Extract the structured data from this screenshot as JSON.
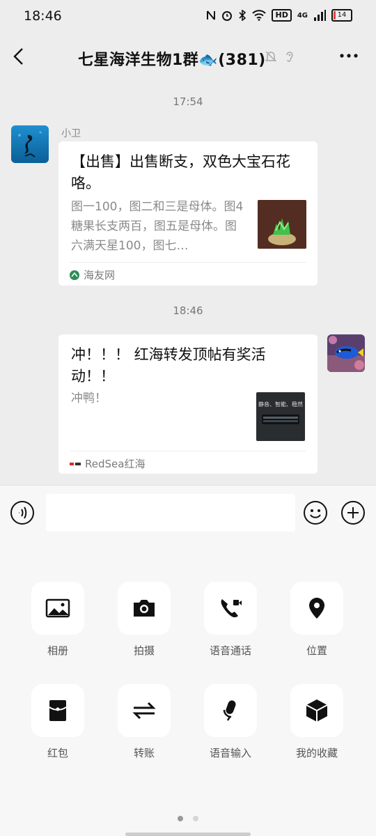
{
  "status_bar": {
    "time": "18:46",
    "hd_label": "HD",
    "network_label": "4G",
    "battery": "14",
    "battery_level": 0.14
  },
  "header": {
    "title": "七星海洋生物1群🐟(381)"
  },
  "messages": {
    "time1": "17:54",
    "sender_name": "小卫",
    "card1": {
      "title": "【出售】出售断支，双色大宝石花咯。",
      "desc": "图一100，图二和三是母体。图4糖果长支两百，图五是母体。图六满天星100，图七…",
      "source": "海友网"
    },
    "time2": "18:46",
    "card2": {
      "title": "冲！！！ 红海转发顶帖有奖活动！！",
      "desc": "冲鸭！",
      "thumb_text": "静音、智能、稳然",
      "source": "RedSea红海"
    }
  },
  "input": {
    "placeholder": ""
  },
  "panel": {
    "items": [
      {
        "label": "相册",
        "icon": "album-icon"
      },
      {
        "label": "拍摄",
        "icon": "camera-icon"
      },
      {
        "label": "语音通话",
        "icon": "voice-call-icon"
      },
      {
        "label": "位置",
        "icon": "location-icon"
      },
      {
        "label": "红包",
        "icon": "red-packet-icon"
      },
      {
        "label": "转账",
        "icon": "transfer-icon"
      },
      {
        "label": "语音输入",
        "icon": "voice-input-icon"
      },
      {
        "label": "我的收藏",
        "icon": "favorites-icon"
      }
    ],
    "active_page": 1
  },
  "colors": {
    "background": "#ededed",
    "card": "#ffffff",
    "battery_low": "#e64340"
  }
}
